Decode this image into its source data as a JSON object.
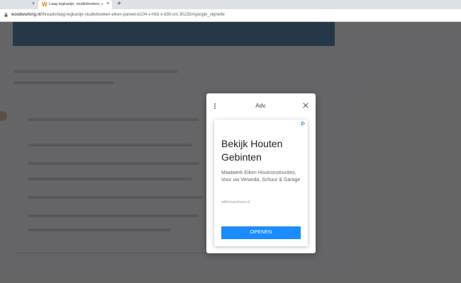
{
  "browser": {
    "tabs": [
      {
        "title": "",
        "close": "×"
      },
      {
        "title": "Laag legkastje, studieboeken, eik",
        "favicon": "W",
        "close": "×",
        "active": true
      }
    ],
    "new_tab": "+",
    "address": {
      "host": "woodworking.nl",
      "path": "/threads/laag-legkastje-studieboeken-eiken-paneel-b104-x-h63-x-d30-cm.30225/#google_vignette"
    }
  },
  "dialog": {
    "title": "Adv.",
    "menu_icon": "more-vert-icon",
    "close_icon": "close-icon"
  },
  "ad": {
    "choices_icon": "adchoices-icon",
    "headline": "Bekijk Houten Gebinten",
    "description": "Maatwerk Eiken Houtconstructies. Voor uw Veranda, Schuur & Garage",
    "domain": "willemsenhout.nl",
    "cta": "OPENEN"
  },
  "colors": {
    "cta": "#1a8cff",
    "page_header": "#3d6f9a",
    "favicon": "#e8791a"
  }
}
